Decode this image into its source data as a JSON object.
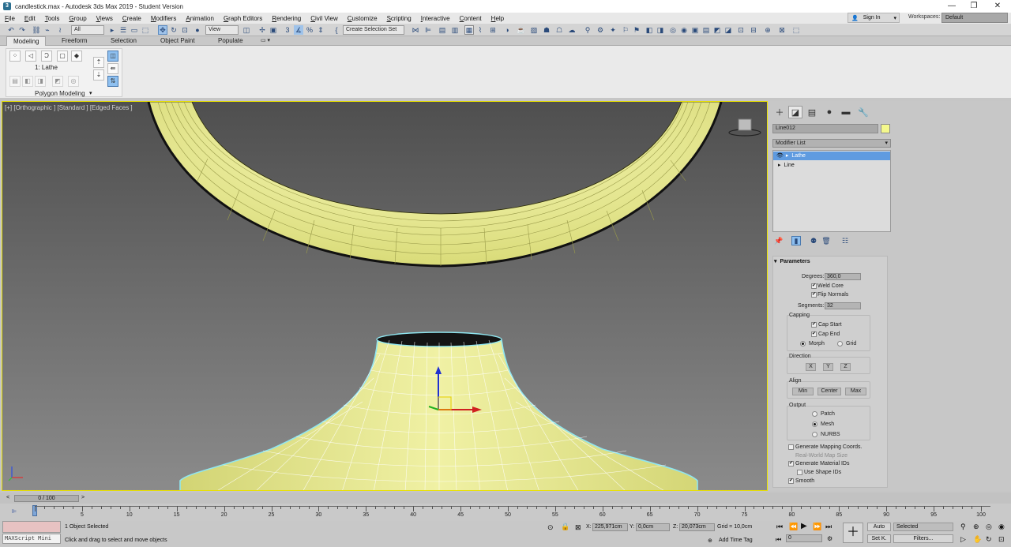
{
  "window": {
    "title": "candlestick.max - Autodesk 3ds Max 2019 - Student Version",
    "minimize": "—",
    "maximize": "❐",
    "close": "✕"
  },
  "menu": [
    "File",
    "Edit",
    "Tools",
    "Group",
    "Views",
    "Create",
    "Modifiers",
    "Animation",
    "Graph Editors",
    "Rendering",
    "Civil View",
    "Customize",
    "Scripting",
    "Interactive",
    "Content",
    "Help"
  ],
  "account": {
    "sign_in": "Sign In",
    "workspaces_label": "Workspaces:",
    "workspace": "Default"
  },
  "toolbar": {
    "selection_filter": "All",
    "ref_coord": "View",
    "selection_set": "Create Selection Set"
  },
  "ribbon": {
    "tabs": [
      "Modeling",
      "Freeform",
      "Selection",
      "Object Paint",
      "Populate"
    ],
    "active_tab": "Modeling",
    "modifier_label": "1: Lathe",
    "panel_title": "Polygon Modeling"
  },
  "viewport": {
    "label": "[+] [Orthographic ] [Standard ] [Edged Faces ]",
    "accent": "#e8e000",
    "mesh_color": "#eef092",
    "selection_outline": "#8fe6f0"
  },
  "command_panel": {
    "object_name": "Line012",
    "object_color": "#f4f88c",
    "modifier_list": "Modifier List",
    "stack": [
      {
        "label": "Lathe",
        "selected": true
      },
      {
        "label": "Line",
        "selected": false
      }
    ]
  },
  "parameters": {
    "title": "Parameters",
    "degrees_label": "Degrees:",
    "degrees": "360,0",
    "weld_core": "Weld Core",
    "flip_normals": "Flip Normals",
    "segments_label": "Segments:",
    "segments": "32",
    "capping": "Capping",
    "cap_start": "Cap Start",
    "cap_end": "Cap End",
    "morph": "Morph",
    "grid": "Grid",
    "direction": "Direction",
    "x": "X",
    "y": "Y",
    "z": "Z",
    "align": "Align",
    "min": "Min",
    "center": "Center",
    "max": "Max",
    "output": "Output",
    "patch": "Patch",
    "mesh": "Mesh",
    "nurbs": "NURBS",
    "gen_mapping": "Generate Mapping Coords.",
    "real_world": "Real-World Map Size",
    "gen_matids": "Generate Material IDs",
    "use_shape_ids": "Use Shape IDs",
    "smooth": "Smooth"
  },
  "timeline": {
    "frame": "0 / 100",
    "ticks": [
      5,
      10,
      15,
      20,
      25,
      30,
      35,
      40,
      45,
      50,
      55,
      60,
      65,
      70,
      75,
      80,
      85,
      90,
      95,
      100
    ]
  },
  "status": {
    "maxscript": "MAXScript Mini",
    "selected": "1 Object Selected",
    "hint": "Click and drag to select and move objects",
    "x": "225,971cm",
    "y": "0,0cm",
    "z": "20,073cm",
    "grid": "Grid = 10,0cm",
    "add_time_tag": "Add Time Tag",
    "auto": "Auto",
    "set_key": "Set K.",
    "key_filter": "Selected",
    "filters": "Filters...",
    "current_frame": "0"
  }
}
